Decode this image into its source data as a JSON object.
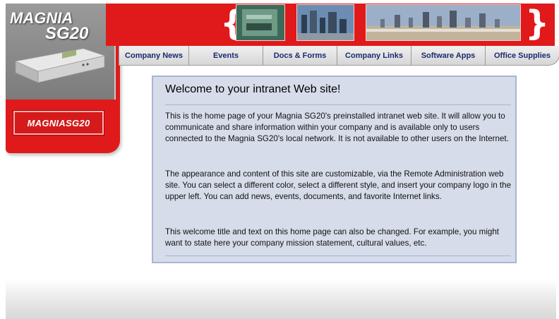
{
  "brand": {
    "logo_line1": "MAGNIA",
    "logo_line2": "SG20",
    "badge_text": "MAGNIASG20"
  },
  "nav": {
    "tabs": [
      "Company News",
      "Events",
      "Docs & Forms",
      "Company Links",
      "Software Apps",
      "Office Supplies"
    ]
  },
  "content": {
    "title": "Welcome to your intranet Web site!",
    "paragraphs": [
      "This is the home page of your Magnia SG20's preinstalled intranet web site. It will allow you to communicate and share information within your company and is available only to users connected to the Magnia SG20's local network. It is not available to other users on the Internet.",
      "The appearance and content of this site are customizable, via the Remote Administration web site. You can select a different color, select a different style, and insert your company logo in the upper left. You can add news, events, documents, and favorite Internet links.",
      "This welcome title and text on this home page can also be changed. For example, you might want to state here your company mission statement, cultural values, etc."
    ]
  },
  "colors": {
    "brand_red": "#e01a1a",
    "card_bg": "#d7dcea",
    "nav_text": "#1a2a6e"
  }
}
